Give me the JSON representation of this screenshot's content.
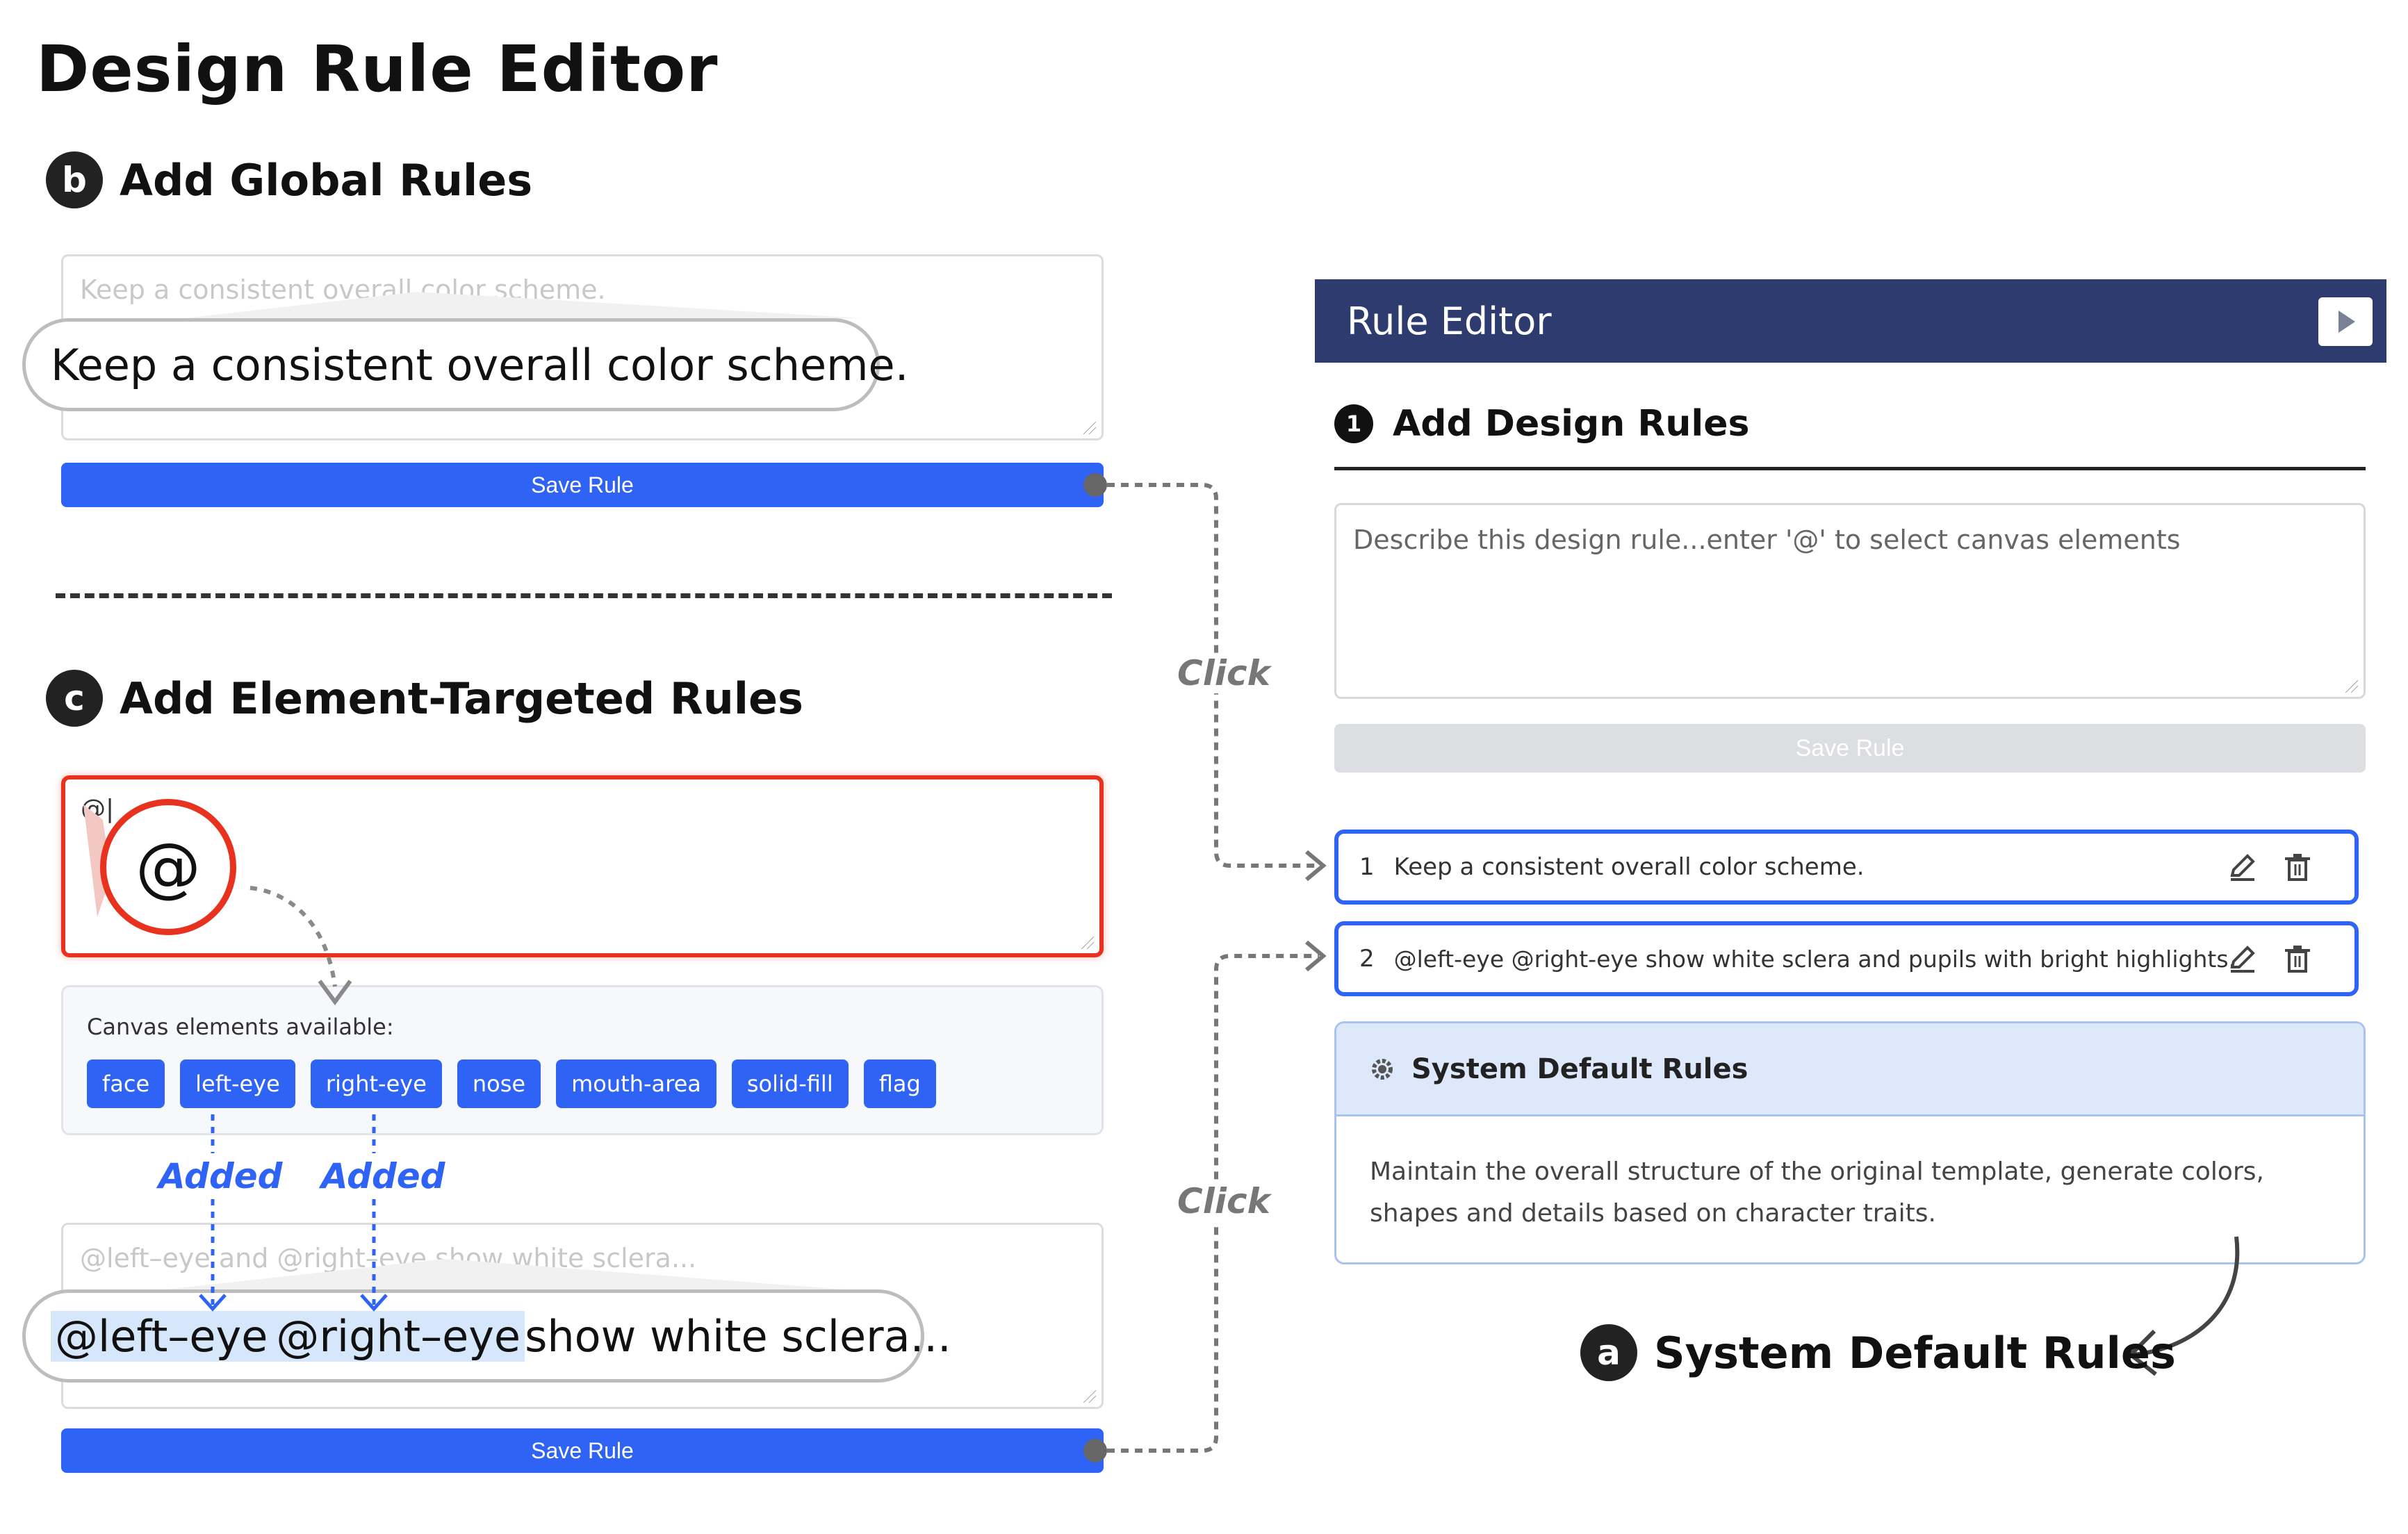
{
  "title": "Design Rule Editor",
  "section_b": {
    "badge": "b",
    "title": "Add Global Rules",
    "placeholder": "Keep a consistent overall color scheme.",
    "zoom_text": "Keep a consistent overall color scheme.",
    "save_label": "Save Rule"
  },
  "section_c": {
    "badge": "c",
    "title": "Add Element-Targeted Rules",
    "input_value": "@|",
    "zoom_symbol": "@",
    "canvas_label": "Canvas elements available:",
    "chips": [
      "face",
      "left-eye",
      "right-eye",
      "nose",
      "mouth-area",
      "solid-fill",
      "flag"
    ],
    "added_label": "Added",
    "result_placeholder": "@left–eye and @right–eye show white sclera...",
    "result_tags": [
      "@left–eye",
      "@right–eye"
    ],
    "result_rest": "show white sclera...",
    "save_label": "Save Rule"
  },
  "click_label": "Click",
  "rule_editor": {
    "header_title": "Rule Editor",
    "section_num": "1",
    "section_title": "Add Design Rules",
    "input_placeholder": "Describe this design rule...enter '@' to select canvas elements",
    "save_label": "Save Rule",
    "rules": [
      {
        "num": "1",
        "text": "Keep a consistent overall color scheme."
      },
      {
        "num": "2",
        "text": "@left-eye @right-eye show white sclera and pupils with bright highlights."
      }
    ],
    "default_rules": {
      "title": "System Default Rules",
      "body": "Maintain the overall structure of the original template, generate colors, shapes and details based on character traits."
    }
  },
  "callout_a": {
    "badge": "a",
    "title": "System Default Rules"
  },
  "colors": {
    "accent": "#2f63f5",
    "header": "#2d3b6f",
    "highlight_red": "#e8321e",
    "disabled": "#dcdee2"
  }
}
